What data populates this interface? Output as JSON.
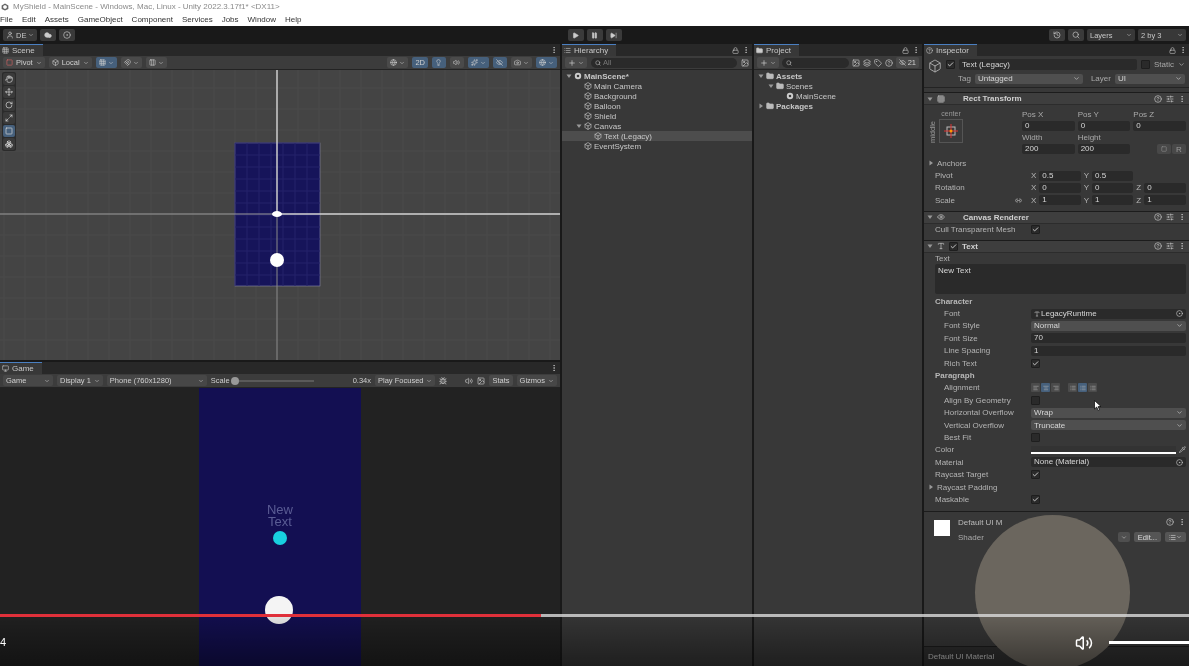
{
  "window": {
    "title": "MyShield - MainScene - Windows, Mac, Linux - Unity 2022.3.17f1* <DX11>"
  },
  "menu": [
    "File",
    "Edit",
    "Assets",
    "GameObject",
    "Component",
    "Services",
    "Jobs",
    "Window",
    "Help"
  ],
  "toolbar": {
    "account": "DE",
    "layers": "Layers",
    "layout": "2 by 3"
  },
  "scene": {
    "tab": "Scene",
    "pivot": "Pivot",
    "space": "Local",
    "mode_2d": {
      "label": "2D",
      "on": true
    },
    "tools": [
      {
        "kind": "hand",
        "selected": false
      },
      {
        "kind": "move",
        "selected": false
      },
      {
        "kind": "rotate",
        "selected": false
      },
      {
        "kind": "scale",
        "selected": false
      },
      {
        "kind": "rect",
        "selected": true
      },
      {
        "kind": "transform",
        "selected": false
      }
    ]
  },
  "game": {
    "tab": "Game",
    "view": "Game",
    "display": "Display 1",
    "resolution": "Phone (760x1280)",
    "scale_label": "Scale",
    "scale": {
      "level": 0.02
    },
    "scale_reading": "0.34x",
    "play_mode": "Play Focused",
    "stats": "Stats",
    "gizmos": "Gizmos",
    "text": "New Text"
  },
  "hierarchy": {
    "tab": "Hierarchy",
    "search": {
      "placeholder": "All"
    },
    "items": [
      {
        "label": "MainScene*",
        "kind": "scene",
        "expanded": true,
        "selected": false,
        "children": [
          {
            "label": "Main Camera",
            "kind": "object",
            "selected": false
          },
          {
            "label": "Background",
            "kind": "object",
            "selected": false
          },
          {
            "label": "Balloon",
            "kind": "object",
            "selected": false
          },
          {
            "label": "Shield",
            "kind": "object",
            "selected": false
          },
          {
            "label": "Canvas",
            "kind": "object",
            "expanded": true,
            "selected": false,
            "children": [
              {
                "label": "Text (Legacy)",
                "kind": "object",
                "selected": true
              }
            ]
          },
          {
            "label": "EventSystem",
            "kind": "object",
            "selected": false
          }
        ]
      }
    ]
  },
  "project": {
    "tab": "Project",
    "hidden_count": "21",
    "items": [
      {
        "label": "Assets",
        "kind": "folder",
        "expanded": true,
        "children": [
          {
            "label": "Scenes",
            "kind": "folder",
            "expanded": true,
            "children": [
              {
                "label": "MainScene",
                "kind": "scene"
              }
            ]
          }
        ]
      },
      {
        "label": "Packages",
        "kind": "folder",
        "expanded": false
      }
    ]
  },
  "inspector": {
    "tab": "Inspector",
    "object": {
      "active": true,
      "name": "Text (Legacy)",
      "static_label": "Static",
      "static": false,
      "tag_label": "Tag",
      "tag": "Untagged",
      "layer_label": "Layer",
      "layer": "UI"
    },
    "components": [
      {
        "kind": "rect",
        "title": "Rect Transform",
        "expanded": true,
        "anchor_h": "center",
        "anchor_v": "middle",
        "raw_button": "R",
        "fields": [
          {
            "label": "Pos X",
            "value": "0"
          },
          {
            "label": "Pos Y",
            "value": "0"
          },
          {
            "label": "Pos Z",
            "value": "0"
          },
          {
            "label": "Width",
            "value": "200"
          },
          {
            "label": "Height",
            "value": "200"
          }
        ],
        "rows": [
          {
            "kind": "foldout",
            "label": "Anchors"
          },
          {
            "kind": "vec",
            "label": "Pivot",
            "fields": [
              {
                "axis": "X",
                "value": "0.5"
              },
              {
                "axis": "Y",
                "value": "0.5"
              }
            ]
          },
          {
            "kind": "vec",
            "label": "Rotation",
            "fields": [
              {
                "axis": "X",
                "value": "0"
              },
              {
                "axis": "Y",
                "value": "0"
              },
              {
                "axis": "Z",
                "value": "0"
              }
            ]
          },
          {
            "kind": "vec",
            "label": "Scale",
            "link_icon": true,
            "fields": [
              {
                "axis": "X",
                "value": "1"
              },
              {
                "axis": "Y",
                "value": "1"
              },
              {
                "axis": "Z",
                "value": "1"
              }
            ]
          }
        ]
      },
      {
        "kind": "renderer",
        "title": "Canvas Renderer",
        "expanded": true,
        "rows": [
          {
            "kind": "check",
            "label": "Cull Transparent Mesh",
            "checked": true
          }
        ]
      },
      {
        "kind": "text",
        "title": "Text",
        "enabled": true,
        "expanded": true,
        "rows": [
          {
            "kind": "textarea",
            "label": "Text",
            "value": "New Text"
          },
          {
            "kind": "section",
            "label": "Character",
            "rows": [
              {
                "kind": "object",
                "label": "Font",
                "value": "LegacyRuntime"
              },
              {
                "kind": "dropdown",
                "label": "Font Style",
                "value": "Normal"
              },
              {
                "kind": "field",
                "label": "Font Size",
                "value": "70"
              },
              {
                "kind": "field",
                "label": "Line Spacing",
                "value": "1"
              },
              {
                "kind": "check",
                "label": "Rich Text",
                "checked": true
              }
            ]
          },
          {
            "kind": "section",
            "label": "Paragraph",
            "rows": [
              {
                "kind": "align",
                "label": "Alignment",
                "buttons": [
                  {
                    "selected": false
                  },
                  {
                    "selected": true
                  },
                  {
                    "selected": false
                  },
                  {
                    "selected": false
                  },
                  {
                    "selected": true
                  },
                  {
                    "selected": false
                  }
                ]
              },
              {
                "kind": "check",
                "label": "Align By Geometry",
                "checked": false
              },
              {
                "kind": "dropdown",
                "label": "Horizontal Overflow",
                "value": "Wrap"
              },
              {
                "kind": "dropdown",
                "label": "Vertical Overflow",
                "value": "Truncate"
              },
              {
                "kind": "check",
                "label": "Best Fit",
                "checked": false
              }
            ]
          },
          {
            "kind": "color",
            "label": "Color"
          },
          {
            "kind": "object",
            "label": "Material",
            "value": "None (Material)"
          },
          {
            "kind": "check",
            "label": "Raycast Target",
            "checked": true
          },
          {
            "kind": "foldout",
            "label": "Raycast Padding"
          },
          {
            "kind": "check",
            "label": "Maskable",
            "checked": true
          }
        ]
      }
    ],
    "material": {
      "name": "Default UI M",
      "shader_label": "Shader",
      "edit": "Edit..."
    },
    "preview_label": "Default UI Material"
  },
  "video": {
    "progress": {
      "level": 0.455
    },
    "time": "4",
    "volume": {
      "level": 1
    }
  }
}
